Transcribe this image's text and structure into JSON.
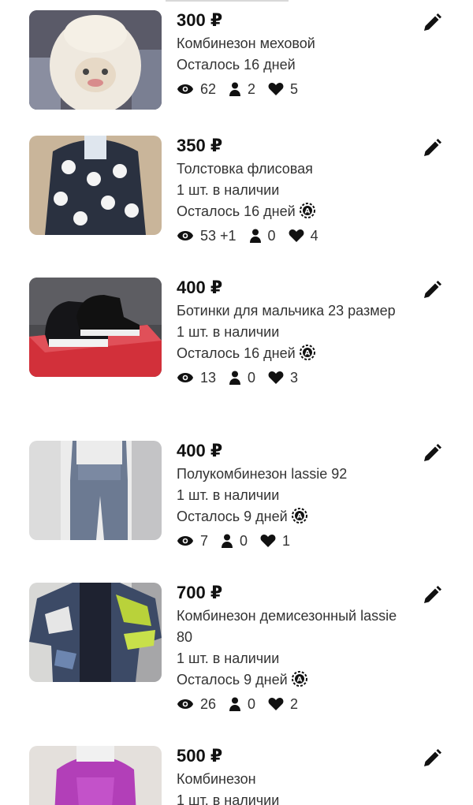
{
  "listings": [
    {
      "price": "300 ₽",
      "title": "Комбинезон меховой",
      "stock": "",
      "expires": "Осталось 16 дней",
      "promo_icon": false,
      "views": "62",
      "contacts": "2",
      "likes": "5"
    },
    {
      "price": "350 ₽",
      "title": "Толстовка флисовая",
      "stock": "1 шт. в наличии",
      "expires": "Осталось 16 дней",
      "promo_icon": true,
      "views": "53 +1",
      "contacts": "0",
      "likes": "4"
    },
    {
      "price": "400 ₽",
      "title": "Ботинки для мальчика 23 размер",
      "stock": "1 шт. в наличии",
      "expires": "Осталось 16 дней",
      "promo_icon": true,
      "views": "13",
      "contacts": "0",
      "likes": "3"
    },
    {
      "price": "400 ₽",
      "title": "Полукомбинезон lassie 92",
      "stock": "1 шт. в наличии",
      "expires": "Осталось 9 дней",
      "promo_icon": true,
      "views": "7",
      "contacts": "0",
      "likes": "1"
    },
    {
      "price": "700 ₽",
      "title": "Комбинезон демисезонный lassie 80",
      "stock": "1 шт. в наличии",
      "expires": "Осталось 9 дней",
      "promo_icon": true,
      "views": "26",
      "contacts": "0",
      "likes": "2"
    },
    {
      "price": "500 ₽",
      "title": "Комбинезон",
      "stock": "1 шт. в наличии",
      "expires": "",
      "promo_icon": false,
      "views": "",
      "contacts": "",
      "likes": ""
    }
  ],
  "icons": {
    "views": "eye-icon",
    "contacts": "person-icon",
    "likes": "heart-icon",
    "edit": "pencil-icon",
    "promo": "promo-badge-icon"
  },
  "colors": {
    "text": "#222222",
    "icon": "#111111"
  }
}
